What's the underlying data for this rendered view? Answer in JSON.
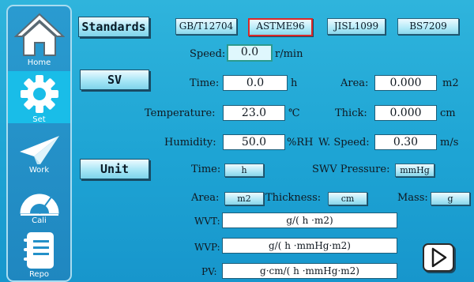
{
  "sidebar": {
    "items": [
      {
        "label": "Home",
        "icon": "home-icon"
      },
      {
        "label": "Set",
        "icon": "gear-icon"
      },
      {
        "label": "Work",
        "icon": "paper-plane-icon"
      },
      {
        "label": "Cali",
        "icon": "protractor-icon"
      },
      {
        "label": "Repo",
        "icon": "notebook-icon"
      }
    ],
    "active": "Set"
  },
  "buttons": {
    "standards": "Standards",
    "sv": "SV",
    "unit": "Unit"
  },
  "standards": {
    "options": [
      "GB/T12704",
      "ASTME96",
      "JISL1099",
      "BS7209"
    ],
    "selected": "ASTME96"
  },
  "speed": {
    "label": "Speed:",
    "value": "0.0",
    "unit": "r/min"
  },
  "sv": {
    "time": {
      "label": "Time:",
      "value": "0.0",
      "unit": "h"
    },
    "area": {
      "label": "Area:",
      "value": "0.000",
      "unit": "m2"
    },
    "temperature": {
      "label": "Temperature:",
      "value": "23.0",
      "unit": "℃"
    },
    "thick": {
      "label": "Thick:",
      "value": "0.000",
      "unit": "cm"
    },
    "humidity": {
      "label": "Humidity:",
      "value": "50.0",
      "unit": "%RH"
    },
    "wspeed": {
      "label": "W. Speed:",
      "value": "0.30",
      "unit": "m/s"
    }
  },
  "units": {
    "time": {
      "label": "Time:",
      "value": "h"
    },
    "swv_pressure": {
      "label": "SWV Pressure:",
      "value": "mmHg"
    },
    "area": {
      "label": "Area:",
      "value": "m2"
    },
    "thickness": {
      "label": "Thickness:",
      "value": "cm"
    },
    "mass": {
      "label": "Mass:",
      "value": "g"
    }
  },
  "results": {
    "wvt": {
      "label": "WVT:",
      "value": "g/( h ·m2)"
    },
    "wvp": {
      "label": "WVP:",
      "value": "g/( h ·mmHg·m2)"
    },
    "pv": {
      "label": "PV:",
      "value": "g·cm/( h ·mmHg·m2)"
    }
  },
  "colors": {
    "background": "#1ea4d4",
    "sidebar": "#2390c8",
    "active_nav": "#19bde8",
    "selected_border": "#d92a2a",
    "field": "#ffffff"
  }
}
